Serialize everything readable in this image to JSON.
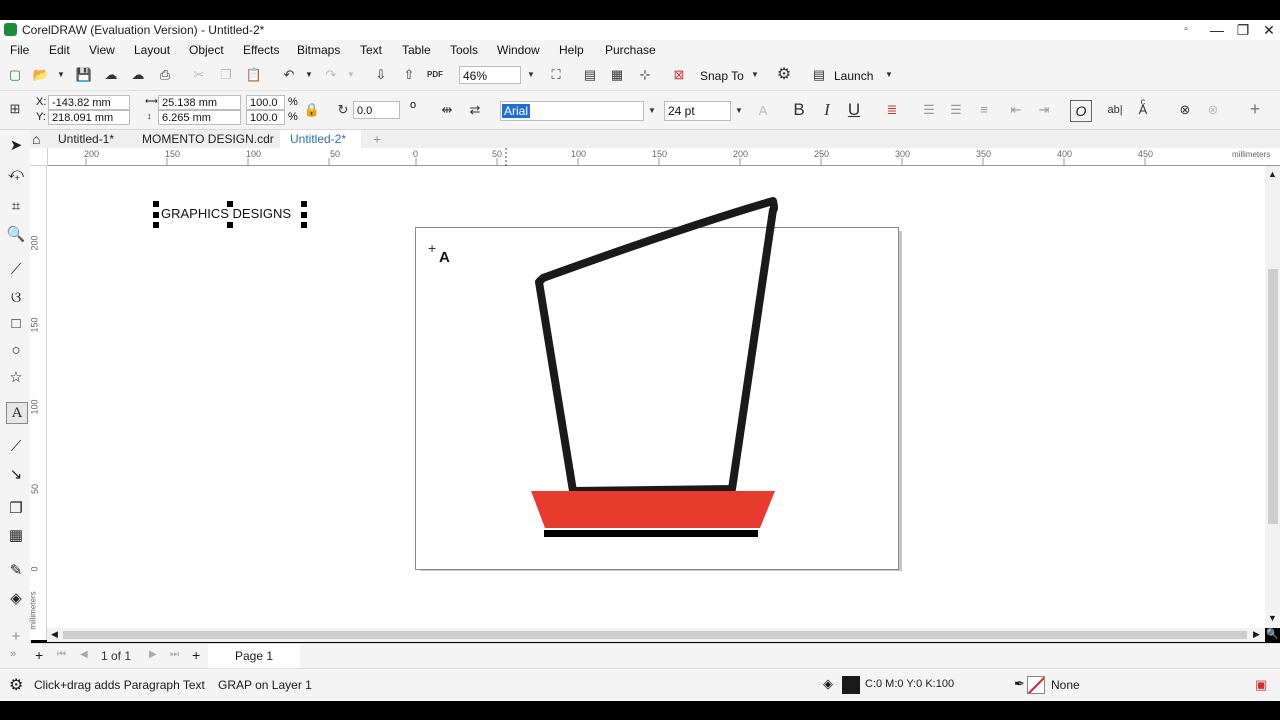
{
  "app": {
    "title": "CorelDRAW (Evaluation Version) - Untitled-2*",
    "window_controls": [
      "▫",
      "—",
      "❐",
      "✕"
    ]
  },
  "menu": [
    "File",
    "Edit",
    "View",
    "Layout",
    "Object",
    "Effects",
    "Bitmaps",
    "Text",
    "Table",
    "Tools",
    "Window",
    "Help",
    "Purchase"
  ],
  "toolbar": {
    "zoom": "46%",
    "snap_to": "Snap To",
    "launch": "Launch",
    "pdf_label": "PDF"
  },
  "properties": {
    "x_label": "X:",
    "x_value": "-143.82 mm",
    "y_label": "Y:",
    "y_value": "218.091 mm",
    "width": "25.138 mm",
    "height": "6.265 mm",
    "scale_x": "100.0",
    "scale_y": "100.0",
    "percent": "%",
    "rotation": "0.0",
    "degree": "o",
    "font_name": "Arial",
    "font_size": "24 pt",
    "bold": "B",
    "italic": "I",
    "underline": "U",
    "fonts_icon": "O",
    "abl": "ab|"
  },
  "documents": {
    "tabs": [
      "Untitled-1*",
      "MOMENTO DESIGN.cdr",
      "Untitled-2*"
    ],
    "active_index": 2,
    "add": "+"
  },
  "ruler": {
    "h_ticks": [
      "200",
      "150",
      "100",
      "50",
      "0",
      "50",
      "100",
      "150",
      "200",
      "250",
      "300",
      "350",
      "400",
      "450"
    ],
    "v_ticks": [
      "200",
      "150",
      "100",
      "50",
      "0"
    ],
    "units": "millimeters"
  },
  "canvas": {
    "text_object": "GRAPHICS DESIGNS",
    "colors": {
      "stroke": "#1a1a1a",
      "base_fill": "#e63b2e",
      "base_line": "#000000"
    }
  },
  "pages": {
    "counter": "1 of 1",
    "tab": "Page 1"
  },
  "status": {
    "hint": "Click+drag adds Paragraph Text",
    "object": "GRAP on Layer 1",
    "fill_color": "C:0 M:0 Y:0 K:100",
    "outline": "None"
  }
}
